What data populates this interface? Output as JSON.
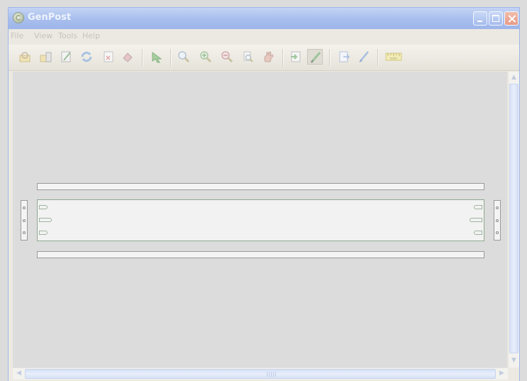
{
  "window": {
    "title": "GenPost"
  },
  "menu": {
    "items": [
      "File",
      "View",
      "Tools",
      "Help"
    ]
  },
  "toolbar": {
    "tools": [
      {
        "icon": "open-project-icon"
      },
      {
        "icon": "open-template-icon"
      },
      {
        "icon": "edit-properties-icon"
      },
      {
        "icon": "refresh-icon"
      },
      {
        "icon": "delete-page-icon"
      },
      {
        "icon": "eraser-icon"
      },
      {
        "icon": "select-arrow-icon"
      },
      {
        "icon": "zoom-icon"
      },
      {
        "icon": "zoom-in-icon"
      },
      {
        "icon": "zoom-out-icon"
      },
      {
        "icon": "zoom-page-icon"
      },
      {
        "icon": "pan-hand-icon"
      },
      {
        "icon": "import-icon"
      },
      {
        "icon": "pen-draw-icon"
      },
      {
        "icon": "export-page-icon"
      },
      {
        "icon": "brush-icon"
      },
      {
        "icon": "ruler-mm-icon"
      }
    ],
    "ruler_label": "mm"
  },
  "colors": {
    "titlebar": "#a9bfee",
    "canvas": "#dcdcdc",
    "panel_border": "#8fa88f"
  }
}
